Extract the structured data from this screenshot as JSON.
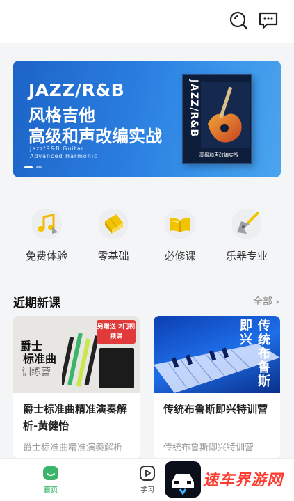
{
  "banner": {
    "line1": "JAZZ/R&B",
    "line2": "风格吉他",
    "line3": "高级和声改编实战",
    "sub1": "Jazz/R&B Guitar",
    "sub2": "Advanced Harmonic",
    "book_spine": "JAZZ/R&B",
    "book_caption": "高级和声改编实战",
    "slide_count": 2,
    "active_slide": 1
  },
  "categories": [
    {
      "label": "免费体验",
      "icon": "music-note-icon"
    },
    {
      "label": "零基础",
      "icon": "book-icon"
    },
    {
      "label": "必修课",
      "icon": "open-book-icon"
    },
    {
      "label": "乐器专业",
      "icon": "guitar-icon"
    }
  ],
  "section": {
    "title": "近期新课",
    "more": "全部 ›"
  },
  "courses": [
    {
      "title": "爵士标准曲精准演奏解析-黄健怡",
      "subtitle": "爵士标准曲精准演奏解析",
      "thumb_title1": "爵士",
      "thumb_title2": "标准曲",
      "thumb_title3": "训练营",
      "thumb_badge": "另赠送 2门视频课"
    },
    {
      "title": "传统布鲁斯即兴特训营",
      "subtitle": "传统布鲁斯即兴特训营",
      "thumb_vertical": "传统布鲁斯即兴"
    }
  ],
  "tabs": [
    {
      "label": "首页",
      "icon": "home-icon",
      "active": true
    },
    {
      "label": "学习",
      "icon": "play-icon",
      "active": false
    }
  ],
  "watermark": {
    "text": "速车界游网"
  },
  "colors": {
    "accent": "#3ab56a",
    "banner": "#2a7ee0",
    "badge": "#e03a3a"
  }
}
